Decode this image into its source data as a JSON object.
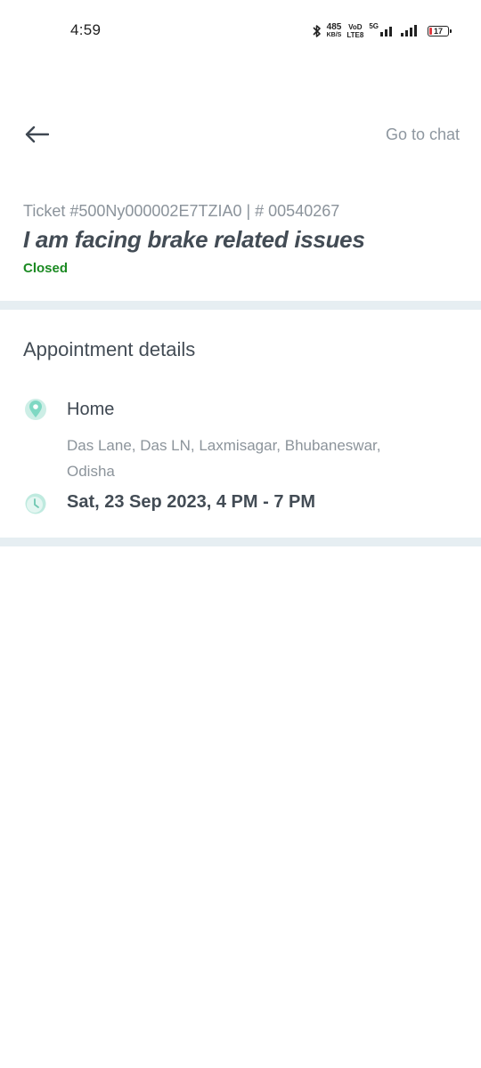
{
  "status_bar": {
    "time": "4:59",
    "speed_value": "485",
    "speed_unit": "KB/S",
    "volte_top": "VoD",
    "volte_bottom": "LTE8",
    "network": "5G",
    "battery": "17"
  },
  "header": {
    "back_icon": "arrow-left-icon",
    "go_to_chat": "Go to chat"
  },
  "ticket": {
    "id_line": "Ticket #500Ny000002E7TZIA0 | # 00540267",
    "title": "I am facing brake related issues",
    "status": "Closed",
    "status_color": "#1b8a22"
  },
  "appointment": {
    "section_title": "Appointment details",
    "location_icon": "location-pin-icon",
    "location_name": "Home",
    "address": "Das Lane, Das LN, Laxmisagar, Bhubaneswar, Odisha",
    "time_icon": "clock-icon",
    "time": "Sat, 23 Sep 2023, 4 PM - 7 PM"
  },
  "colors": {
    "accent_teal": "#7fd8c3",
    "divider": "#e6eef2"
  }
}
